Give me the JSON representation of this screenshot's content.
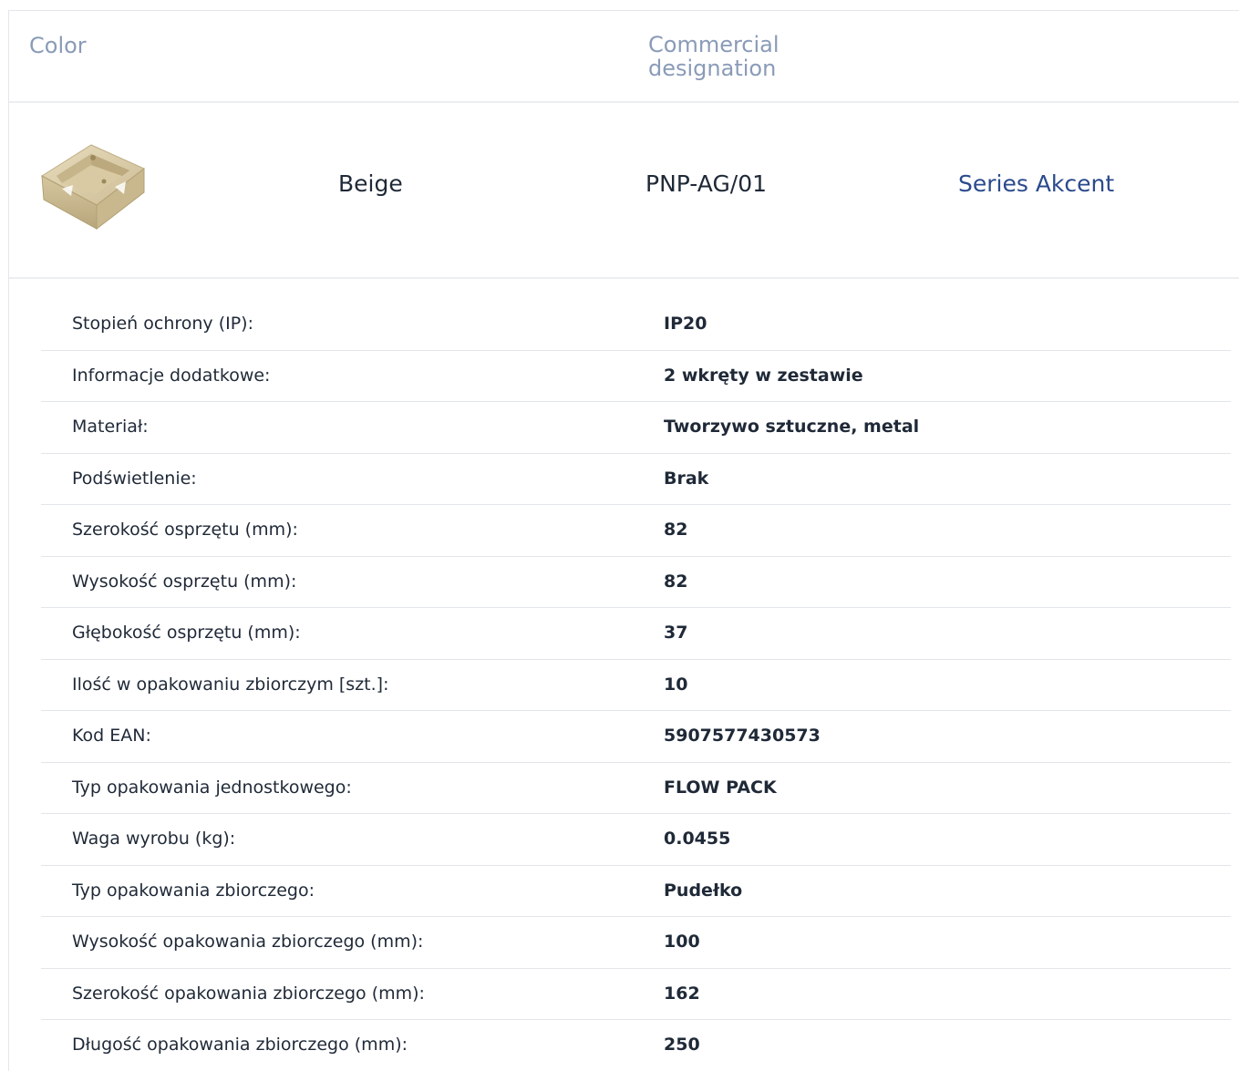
{
  "header": {
    "color_label": "Color",
    "commercial_label": "Commercial designation"
  },
  "product": {
    "image_icon": "beige-mounting-box",
    "color": "Beige",
    "code": "PNP-AG/01",
    "series": "Series Akcent"
  },
  "specs": [
    {
      "label": "Stopień ochrony (IP):",
      "value": "IP20"
    },
    {
      "label": "Informacje dodatkowe:",
      "value": "2 wkręty w zestawie"
    },
    {
      "label": "Materiał:",
      "value": "Tworzywo sztuczne, metal"
    },
    {
      "label": "Podświetlenie:",
      "value": "Brak"
    },
    {
      "label": "Szerokość osprzętu (mm):",
      "value": "82"
    },
    {
      "label": "Wysokość osprzętu (mm):",
      "value": "82"
    },
    {
      "label": "Głębokość osprzętu (mm):",
      "value": "37"
    },
    {
      "label": "Ilość w opakowaniu zbiorczym [szt.]:",
      "value": "10"
    },
    {
      "label": "Kod EAN:",
      "value": "5907577430573"
    },
    {
      "label": "Typ opakowania jednostkowego:",
      "value": "FLOW PACK"
    },
    {
      "label": "Waga wyrobu (kg):",
      "value": "0.0455"
    },
    {
      "label": "Typ opakowania zbiorczego:",
      "value": "Pudełko"
    },
    {
      "label": "Wysokość opakowania zbiorczego (mm):",
      "value": "100"
    },
    {
      "label": "Szerokość opakowania zbiorczego (mm):",
      "value": "162"
    },
    {
      "label": "Długość opakowania zbiorczego (mm):",
      "value": "250"
    }
  ],
  "colors": {
    "header_text": "#8a9bb8",
    "link": "#2a4a8c",
    "body_text": "#1f2937",
    "divider": "#e2e5e9",
    "product_beige": "#d8c9a4"
  }
}
